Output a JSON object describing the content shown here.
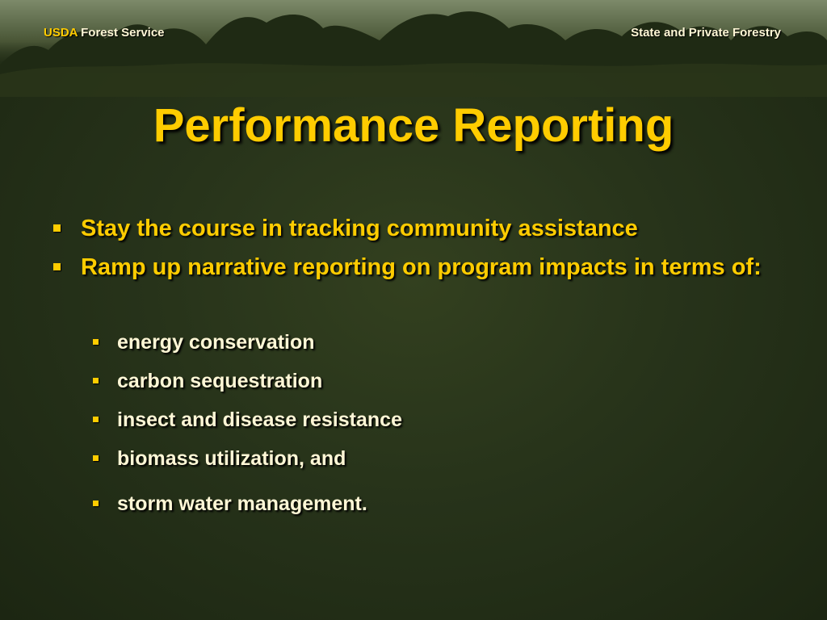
{
  "header": {
    "usda": "USDA",
    "forest_service": "Forest Service",
    "right": "State and Private Forestry"
  },
  "slide": {
    "title": "Performance Reporting",
    "bullets": [
      "Stay the course in tracking community assistance",
      "Ramp up narrative reporting on program impacts in terms of:"
    ],
    "sub_bullets": [
      "energy conservation",
      "carbon sequestration",
      "insect and disease resistance",
      "biomass utilization, and",
      "storm water management."
    ]
  },
  "colors": {
    "title": "#ffcc00",
    "body_text": "#ffcc00",
    "sub_text": "#fff7d6",
    "background": "#27331a"
  },
  "icons": {
    "bullet": "square-bullet-icon"
  }
}
